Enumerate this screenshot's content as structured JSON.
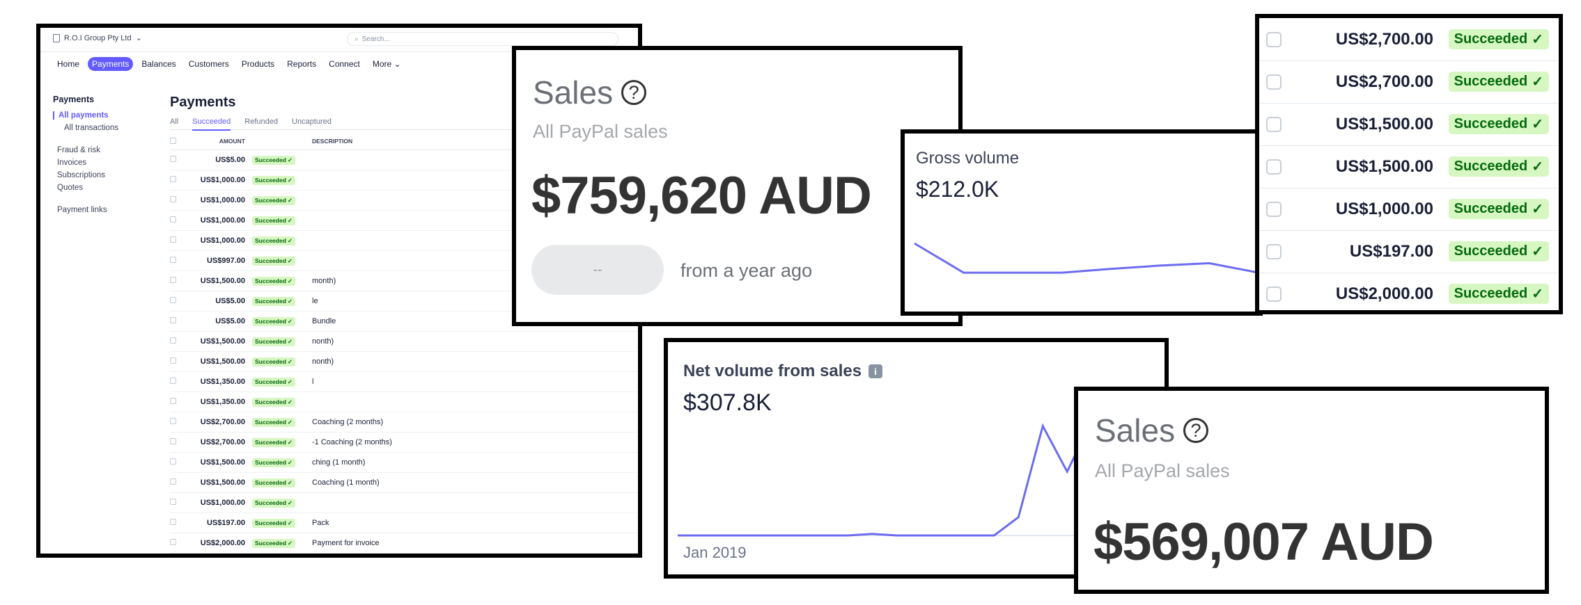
{
  "dashboard": {
    "account": "R.O.I Group Pty Ltd",
    "search_placeholder": "Search...",
    "nav": [
      "Home",
      "Payments",
      "Balances",
      "Customers",
      "Products",
      "Reports",
      "Connect",
      "More"
    ],
    "sidebar": {
      "heading": "Payments",
      "items": [
        "All payments",
        "All transactions",
        "Fraud & risk",
        "Invoices",
        "Subscriptions",
        "Quotes",
        "Payment links"
      ]
    },
    "title": "Payments",
    "tabs": [
      "All",
      "Succeeded",
      "Refunded",
      "Uncaptured"
    ],
    "columns": {
      "amount": "AMOUNT",
      "description": "DESCRIPTION"
    },
    "status_label": "Succeeded",
    "rows": [
      {
        "amount": "US$5.00",
        "desc": ""
      },
      {
        "amount": "US$1,000.00",
        "desc": ""
      },
      {
        "amount": "US$1,000.00",
        "desc": ""
      },
      {
        "amount": "US$1,000.00",
        "desc": ""
      },
      {
        "amount": "US$1,000.00",
        "desc": ""
      },
      {
        "amount": "US$997.00",
        "desc": ""
      },
      {
        "amount": "US$1,500.00",
        "desc": "month)"
      },
      {
        "amount": "US$5.00",
        "desc": "le"
      },
      {
        "amount": "US$5.00",
        "desc": "Bundle"
      },
      {
        "amount": "US$1,500.00",
        "desc": "nonth)"
      },
      {
        "amount": "US$1,500.00",
        "desc": "nonth)"
      },
      {
        "amount": "US$1,350.00",
        "desc": "l"
      },
      {
        "amount": "US$1,350.00",
        "desc": ""
      },
      {
        "amount": "US$2,700.00",
        "desc": "Coaching (2 months)"
      },
      {
        "amount": "US$2,700.00",
        "desc": "-1 Coaching (2 months)"
      },
      {
        "amount": "US$1,500.00",
        "desc": "ching (1 month)"
      },
      {
        "amount": "US$1,500.00",
        "desc": "Coaching (1 month)"
      },
      {
        "amount": "US$1,000.00",
        "desc": ""
      },
      {
        "amount": "US$197.00",
        "desc": "Pack"
      },
      {
        "amount": "US$2,000.00",
        "desc": "Payment for invoice"
      }
    ]
  },
  "sales1": {
    "title": "Sales",
    "help": "?",
    "subtitle": "All PayPal sales",
    "value": "$759,620 AUD",
    "change": "--",
    "from": "from a year ago"
  },
  "gross": {
    "label": "Gross volume",
    "value": "$212.0K",
    "series": [
      212,
      150,
      150,
      150,
      158,
      165,
      170,
      150
    ],
    "line_color": "#6c6cf0"
  },
  "right_list": {
    "status_label": "Succeeded",
    "rows": [
      "US$2,700.00",
      "US$2,700.00",
      "US$1,500.00",
      "US$1,500.00",
      "US$1,000.00",
      "US$197.00",
      "US$2,000.00"
    ]
  },
  "net": {
    "label": "Net volume from sales",
    "info": "i",
    "value": "$307.8K",
    "start_label": "Jan 2019",
    "series": [
      0,
      0,
      0,
      0,
      0,
      0,
      0,
      0,
      1,
      0,
      0,
      0,
      0,
      0,
      12,
      72,
      42,
      75,
      34,
      36,
      46
    ],
    "line_color": "#6c6cf0"
  },
  "sales2": {
    "title": "Sales",
    "help": "?",
    "subtitle": "All PayPal sales",
    "value": "$569,007 AUD"
  }
}
